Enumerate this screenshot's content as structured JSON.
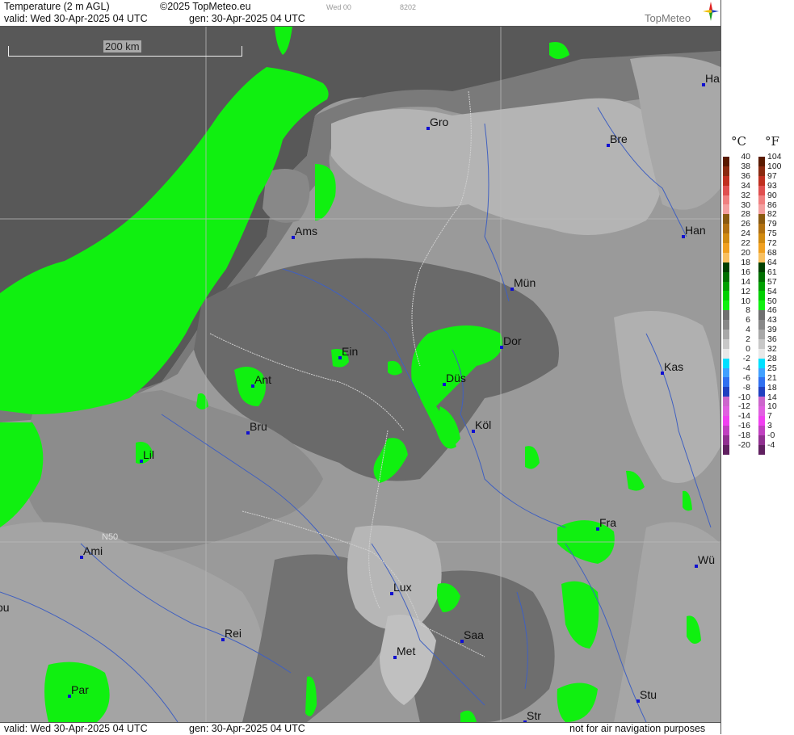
{
  "header": {
    "title": "Temperature (2 m AGL)",
    "copyright": "©2025 TopMeteo.eu",
    "run_small": "Wed 00",
    "id_small": "8202",
    "valid": "valid:  Wed  30-Apr-2025  04 UTC",
    "generated": "gen:  30-Apr-2025 04 UTC",
    "logo_text": "TopMeteo"
  },
  "map": {
    "scale_label": "200 km",
    "lat_label": "N50",
    "cities": [
      {
        "name": "Gro"
      },
      {
        "name": "Bre"
      },
      {
        "name": "Ha"
      },
      {
        "name": "Ams"
      },
      {
        "name": "Han"
      },
      {
        "name": "Mün"
      },
      {
        "name": "Ein"
      },
      {
        "name": "Dor"
      },
      {
        "name": "Kas"
      },
      {
        "name": "Ant"
      },
      {
        "name": "Düs"
      },
      {
        "name": "Bru"
      },
      {
        "name": "Köl"
      },
      {
        "name": "Lil"
      },
      {
        "name": "Fra"
      },
      {
        "name": "Ami"
      },
      {
        "name": "Wü"
      },
      {
        "name": "Lux"
      },
      {
        "name": "ou"
      },
      {
        "name": "Rei"
      },
      {
        "name": "Saa"
      },
      {
        "name": "Met"
      },
      {
        "name": "Par"
      },
      {
        "name": "Stu"
      },
      {
        "name": "Str"
      }
    ]
  },
  "footer": {
    "valid": "valid:  Wed  30-Apr-2025  04 UTC",
    "generated": "gen:  30-Apr-2025 04 UTC",
    "disclaimer": "not for air navigation purposes"
  },
  "legend": {
    "unit_c": "°C",
    "unit_f": "°F",
    "celsius": [
      "40",
      "38",
      "36",
      "34",
      "32",
      "30",
      "28",
      "26",
      "24",
      "22",
      "20",
      "18",
      "16",
      "14",
      "12",
      "10",
      "8",
      "6",
      "4",
      "2",
      "0",
      "-2",
      "-4",
      "-6",
      "-8",
      "-10",
      "-12",
      "-14",
      "-16",
      "-18",
      "-20"
    ],
    "fahrenheit": [
      "104",
      "100",
      "97",
      "93",
      "90",
      "86",
      "82",
      "79",
      "75",
      "72",
      "68",
      "64",
      "61",
      "57",
      "54",
      "50",
      "46",
      "43",
      "39",
      "36",
      "32",
      "28",
      "25",
      "21",
      "18",
      "14",
      "10",
      "7",
      "3",
      "-0",
      "-4"
    ],
    "colors": [
      "#5a1a00",
      "#8a2a10",
      "#c03020",
      "#e05050",
      "#f08080",
      "#f4a0a0",
      "#8a5a10",
      "#b07010",
      "#d08a10",
      "#f0a020",
      "#f8c060",
      "#004000",
      "#007000",
      "#00a000",
      "#00d000",
      "#10f010",
      "#707070",
      "#888888",
      "#a8a8a8",
      "#c8c8c8",
      "#e8e8e8",
      "#00e0ff",
      "#40a0ff",
      "#3070f0",
      "#2040c0",
      "#cc66cc",
      "#e060e0",
      "#f040f0",
      "#c040c0",
      "#903090",
      "#602060"
    ]
  }
}
